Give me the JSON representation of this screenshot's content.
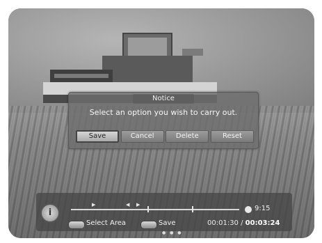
{
  "dialog": {
    "title": "Notice",
    "message": "Select an option you wish to carry out.",
    "buttons": [
      {
        "label": "Save",
        "selected": true
      },
      {
        "label": "Cancel",
        "selected": false
      },
      {
        "label": "Delete",
        "selected": false
      },
      {
        "label": "Reset",
        "selected": false
      }
    ]
  },
  "playback": {
    "info_icon": "info-icon",
    "clock_time": "9:15",
    "select_area_label": "Select Area",
    "save_label": "Save",
    "elapsed": "00:01:30",
    "separator": " / ",
    "total": "00:03:24"
  },
  "colors": {
    "accent": "#d6d6d6",
    "dialog_bg": "#6e6e6e"
  }
}
